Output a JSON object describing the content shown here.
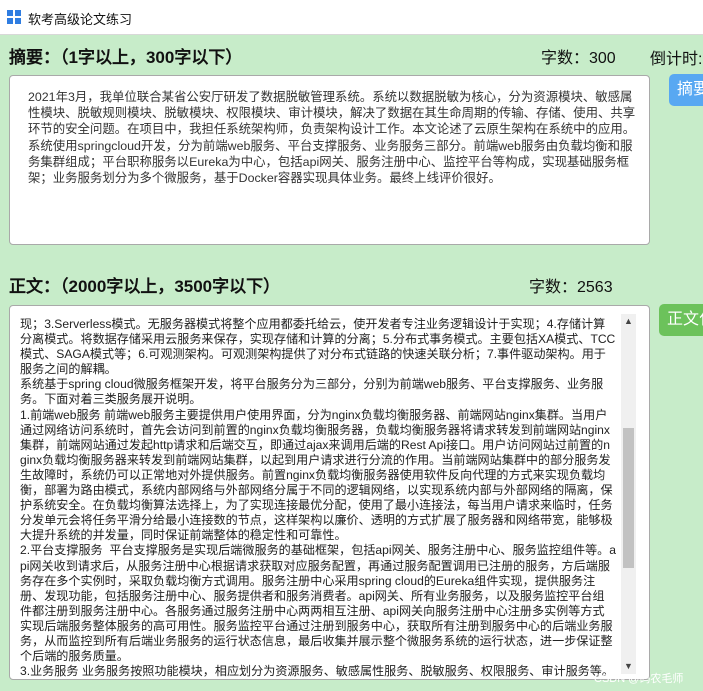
{
  "window": {
    "title": "软考高级论文练习"
  },
  "abstract": {
    "heading": "摘要：（1字以上，300字以下）",
    "count_label": "字数：300",
    "text": "2021年3月，我单位联合某省公安厅研发了数据脱敏管理系统。系统以数据脱敏为核心，分为资源模块、敏感属性模块、脱敏规则模块、脱敏模块、权限模块、审计模块，解决了数据在其生命周期的传输、存储、使用、共享环节的安全问题。在项目中，我担任系统架构师，负责架构设计工作。本文论述了云原生架构在系统中的应用。系统使用springcloud开发，分为前端web服务、平台支撑服务、业务服务三部分。前端web服务由负载均衡和服务集群组成；平台职称服务以Eureka为中心，包括api网关、服务注册中心、监控平台等构成，实现基础服务框架；业务服务划分为多个微服务，基于Docker容器实现具体业务。最终上线评价很好。",
    "button_label": "摘要"
  },
  "countdown": {
    "label": "倒计时:"
  },
  "body": {
    "heading": "正文：（2000字以上，3500字以下）",
    "count_label": "字数：2563",
    "button_label": "正文化",
    "text": "现；3.Serverless模式。无服务器模式将整个应用都委托给云，使开发者专注业务逻辑设计于实现；4.存储计算分离模式。将数据存储采用云服务来保存，实现存储和计算的分离；5.分布式事务模式。主要包括XA模式、TCC模式、SAGA模式等；6.可观测架构。可观测架构提供了对分布式链路的快速关联分析；7.事件驱动架构。用于服务之间的解耦。\n系统基于spring cloud微服务框架开发，将平台服务分为三部分，分别为前端web服务、平台支撑服务、业务服务。下面对着三类服务展开说明。\n1.前端web服务 前端web服务主要提供用户使用界面，分为nginx负载均衡服务器、前端网站nginx集群。当用户通过网络访问系统时，首先会访问到前置的nginx负载均衡服务器，负载均衡服务器将请求转发到前端网站nginx集群，前端网站通过发起http请求和后端交互，即通过ajax来调用后端的Rest Api接口。用户访问网站过前置的nginx负载均衡服务器来转发到前端网站集群，以起到用户请求进行分流的作用。当前端网站集群中的部分服务发生故障时，系统仍可以正常地对外提供服务。前置nginx负载均衡服务器使用软件反向代理的方式来实现负载均衡，部署为路由模式，系统内部网络与外部网络分属于不同的逻辑网络，以实现系统内部与外部网络的隔离，保护系统安全。在负载均衡算法选择上，为了实现连接最优分配，使用了最小连接法，每当用户请求来临时，任务分发单元会将任务平滑分给最小连接数的节点，这样架构以廉价、透明的方式扩展了服务器和网络带宽，能够极大提升系统的并发量，同时保证前端整体的稳定性和可靠性。\n2.平台支撑服务  平台支撑服务是实现后端微服务的基础框架，包括api网关、服务注册中心、服务监控组件等。api网关收到请求后，从服务注册中心根据请求获取对应服务配置，再通过服务配置调用已注册的服务，方后端服务存在多个实例时，采取负载均衡方式调用。服务注册中心采用spring cloud的Eureka组件实现，提供服务注册、发现功能，包括服务注册中心、服务提供者和服务消费者。api网关、所有业务服务，以及服务监控平台组件都注册到服务注册中心。各服务通过服务注册中心两两相互注册、api网关向服务注册中心注册多实例等方式实现后端服务整体服务的高可用性。服务监控平台通过注册到服务中心，获取所有注册到服务中心的后端业务服务，从而监控到所有后端业务服务的运行状态信息，最后收集并展示整个微服务系统的运行状态，进一步保证整个后端的服务质量。\n3.业务服务 业务服务按照功能模块，相应划分为资源服务、敏感属性服务、脱敏服务、权限服务、审计服务等。"
  },
  "watermark": "CSDN @码农毛师",
  "colors": {
    "background": "#c7ecc9",
    "abstract_button": "#58a8f2",
    "body_button": "#6cc25b"
  }
}
